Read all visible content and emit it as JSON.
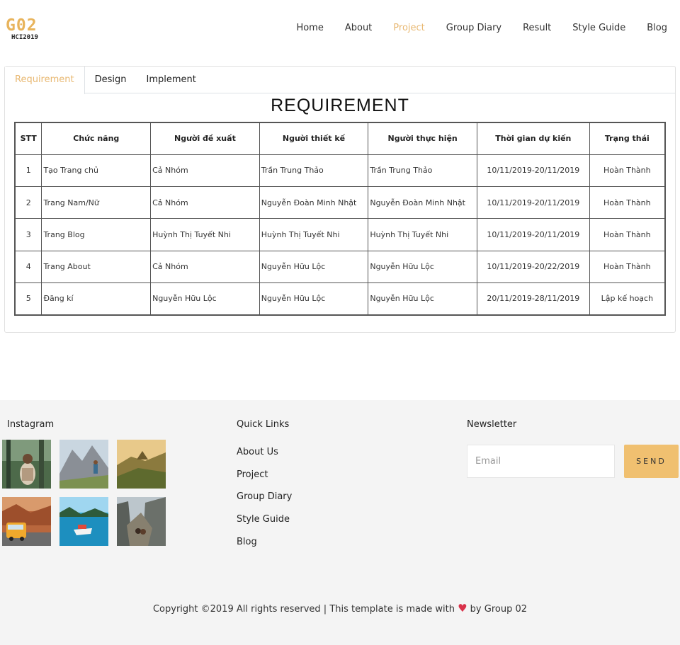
{
  "brand": {
    "logo": "G02",
    "sub": "HCI2019"
  },
  "nav": [
    {
      "label": "Home",
      "active": false
    },
    {
      "label": "About",
      "active": false
    },
    {
      "label": "Project",
      "active": true
    },
    {
      "label": "Group Diary",
      "active": false
    },
    {
      "label": "Result",
      "active": false
    },
    {
      "label": "Style Guide",
      "active": false
    },
    {
      "label": "Blog",
      "active": false
    }
  ],
  "tabs": [
    {
      "label": "Requirement",
      "active": true
    },
    {
      "label": "Design",
      "active": false
    },
    {
      "label": "Implement",
      "active": false
    }
  ],
  "requirement": {
    "title": "REQUIREMENT",
    "columns": [
      "STT",
      "Chức năng",
      "Người đề xuất",
      "Người thiết kế",
      "Người thực hiện",
      "Thời gian dự kiến",
      "Trạng thái"
    ],
    "rows": [
      [
        "1",
        "Tạo Trang chủ",
        "Cả Nhóm",
        "Trần Trung Thảo",
        "Trần Trung Thảo",
        "10/11/2019-20/11/2019",
        "Hoàn Thành"
      ],
      [
        "2",
        "Trang Nam/Nữ",
        "Cả Nhóm",
        "Nguyễn Đoàn Minh Nhật",
        "Nguyễn Đoàn Minh Nhật",
        "10/11/2019-20/11/2019",
        "Hoàn Thành"
      ],
      [
        "3",
        "Trang Blog",
        "Huỳnh Thị Tuyết Nhi",
        "Huỳnh Thị Tuyết Nhi",
        "Huỳnh Thị Tuyết Nhi",
        "10/11/2019-20/11/2019",
        "Hoàn Thành"
      ],
      [
        "4",
        "Trang About",
        "Cả Nhóm",
        "Nguyễn Hữu Lộc",
        "Nguyễn Hữu Lộc",
        "10/11/2019-20/22/2019",
        "Hoàn Thành"
      ],
      [
        "5",
        "Đăng kí",
        "Nguyễn Hữu Lộc",
        "Nguyễn Hữu Lộc",
        "Nguyễn Hữu Lộc",
        "20/11/2019-28/11/2019",
        "Lập kế hoạch"
      ]
    ]
  },
  "footer": {
    "instagram_title": "Instagram",
    "quick_links_title": "Quick Links",
    "quick_links": [
      "About Us",
      "Project",
      "Group Diary",
      "Style Guide",
      "Blog"
    ],
    "newsletter_title": "Newsletter",
    "email_placeholder": "Email",
    "send_label": "SEND",
    "copyright_before": "Copyright ©2019 All rights reserved | This template is made with",
    "copyright_after": "by Group 02"
  },
  "colors": {
    "accent": "#e8b872",
    "send_button": "#f0c070",
    "heart": "#d9324a",
    "footer_bg": "#f4f4f4"
  },
  "icons": {
    "heart": "heart-icon"
  }
}
